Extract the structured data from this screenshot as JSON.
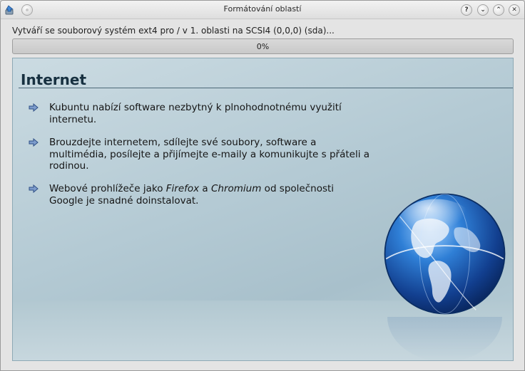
{
  "window": {
    "title": "Formátování oblastí",
    "buttons": {
      "help": "?",
      "minimize": "⌄",
      "maximize": "⌃",
      "close": "✕"
    }
  },
  "status": "Vytváří se souborový systém ext4 pro / v 1. oblasti na SCSI4 (0,0,0) (sda)...",
  "progress": {
    "value": 0,
    "label": "0%"
  },
  "slide": {
    "title": "Internet",
    "bullets": [
      {
        "text": "Kubuntu nabízí software nezbytný k plnohodnotnému využití internetu."
      },
      {
        "text": "Brouzdejte internetem, sdílejte své soubory, software a multimédia, posílejte a přijímejte e-maily a komunikujte s přáteli a rodinou."
      },
      {
        "before": "Webové prohlížeče jako ",
        "em1": "Firefox",
        "middle": " a ",
        "em2": "Chromium",
        "after": " od společnosti Google je snadné doinstalovat."
      }
    ]
  },
  "colors": {
    "accent": "#6fa0d6",
    "slide_title": "#173040",
    "globe": "#1f5fb0"
  },
  "icons": {
    "app": "installer-icon",
    "pin": "pin-icon",
    "bullet": "arrow-right-icon",
    "globe": "globe-icon"
  }
}
